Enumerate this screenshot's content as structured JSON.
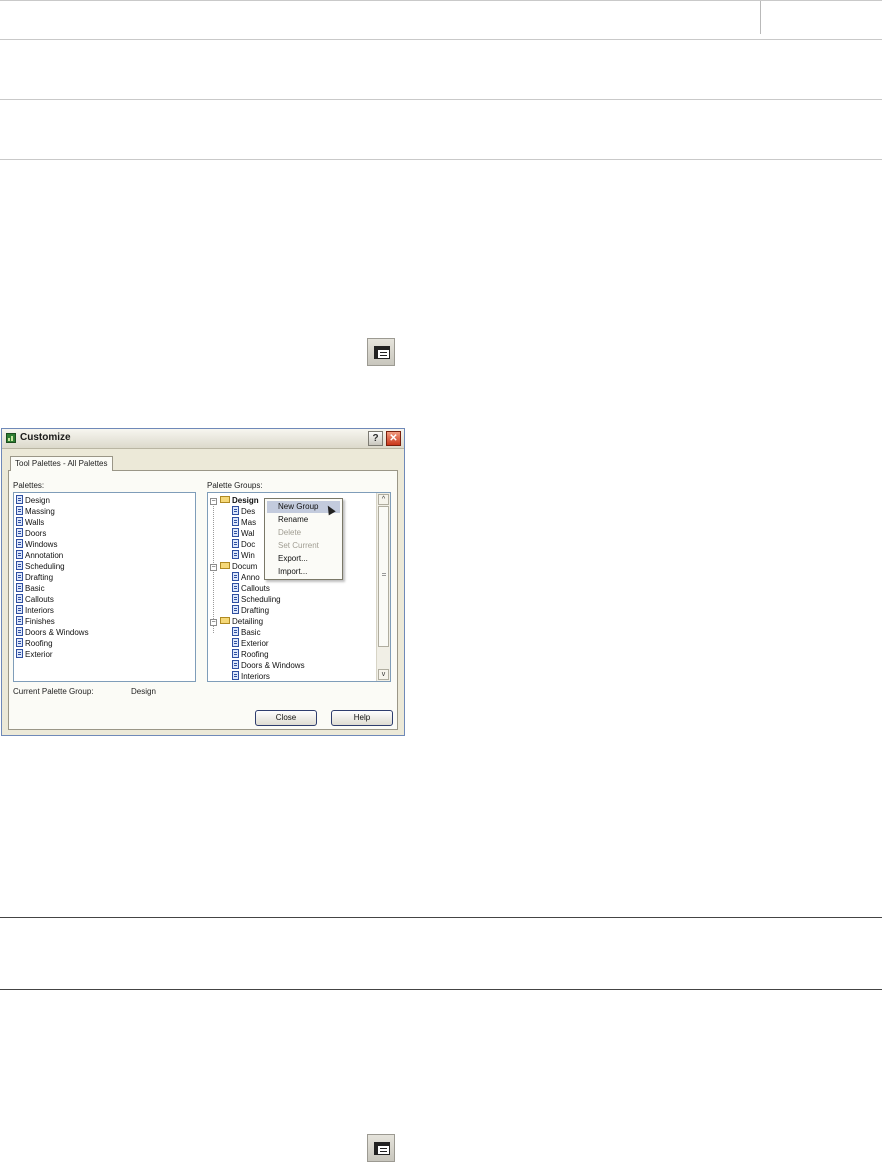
{
  "dialog": {
    "title": "Customize",
    "help_glyph": "?",
    "close_glyph": "✕",
    "tab_label": "Tool Palettes - All Palettes",
    "palettes_label": "Palettes:",
    "palette_groups_label": "Palette Groups:",
    "palettes": [
      "Design",
      "Massing",
      "Walls",
      "Doors",
      "Windows",
      "Annotation",
      "Scheduling",
      "Drafting",
      "Basic",
      "Callouts",
      "Interiors",
      "Finishes",
      "Doors & Windows",
      "Roofing",
      "Exterior"
    ],
    "groups": {
      "design": {
        "name": "Design",
        "toggle": "−",
        "children": [
          "Des",
          "Mas",
          "Wal",
          "Doc",
          "Win"
        ]
      },
      "documentation": {
        "name": "Docum",
        "toggle": "−",
        "children": [
          "Anno",
          "Callouts",
          "Scheduling",
          "Drafting"
        ]
      },
      "detailing": {
        "name": "Detailing",
        "toggle": "−",
        "children": [
          "Basic",
          "Exterior",
          "Roofing",
          "Doors & Windows",
          "Interiors"
        ]
      }
    },
    "context_menu": [
      "New Group",
      "Rename",
      "Delete",
      "Set Current",
      "Export...",
      "Import..."
    ],
    "current_group_label": "Current Palette Group:",
    "current_group_value": "Design",
    "close_button": "Close",
    "help_button": "Help",
    "scroll_up": "^",
    "scroll_down": "v"
  },
  "colors": {
    "dialog_bg": "#ece9d8",
    "selection": "#c3cbdd",
    "close_red": "#c9361b",
    "folder": "#f5d878"
  },
  "icons": [
    "palette-page-icon",
    "folder-icon",
    "tool-palette-icon"
  ]
}
